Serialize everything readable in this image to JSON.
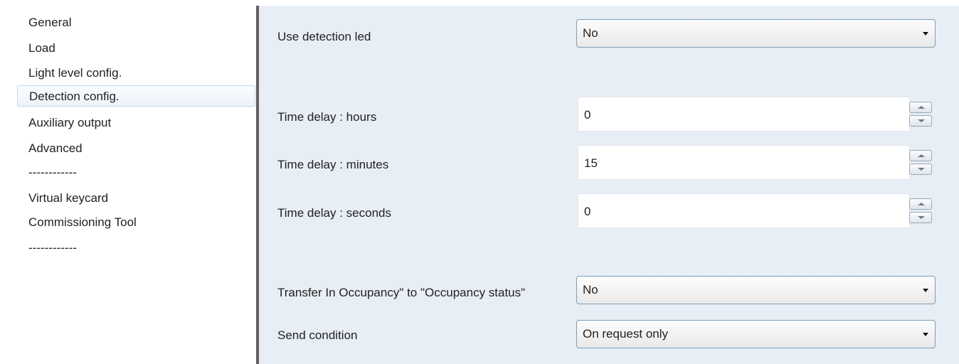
{
  "sidebar": {
    "items": [
      {
        "label": "General"
      },
      {
        "label": "Load"
      },
      {
        "label": "Light level config."
      },
      {
        "label": "Detection config.",
        "selected": true
      },
      {
        "label": "Auxiliary output"
      },
      {
        "label": "Advanced"
      },
      {
        "label": "------------"
      },
      {
        "label": "Virtual keycard"
      },
      {
        "label": "Commissioning Tool"
      },
      {
        "label": "------------"
      }
    ]
  },
  "params": {
    "use_detection_led": {
      "label": "Use detection led",
      "value": "No"
    },
    "time_delay_hours": {
      "label": "Time delay : hours",
      "value": "0"
    },
    "time_delay_minutes": {
      "label": "Time delay : minutes",
      "value": "15"
    },
    "time_delay_seconds": {
      "label": "Time delay : seconds",
      "value": "0"
    },
    "transfer_occupancy": {
      "label": "Transfer In Occupancy\" to \"Occupancy status\"",
      "value": "No"
    },
    "send_condition": {
      "label": "Send condition",
      "value": "On request only"
    }
  },
  "colors": {
    "panel_bg": "#e8eef5",
    "divider": "#606060",
    "selection_border": "#c5d6ea"
  }
}
